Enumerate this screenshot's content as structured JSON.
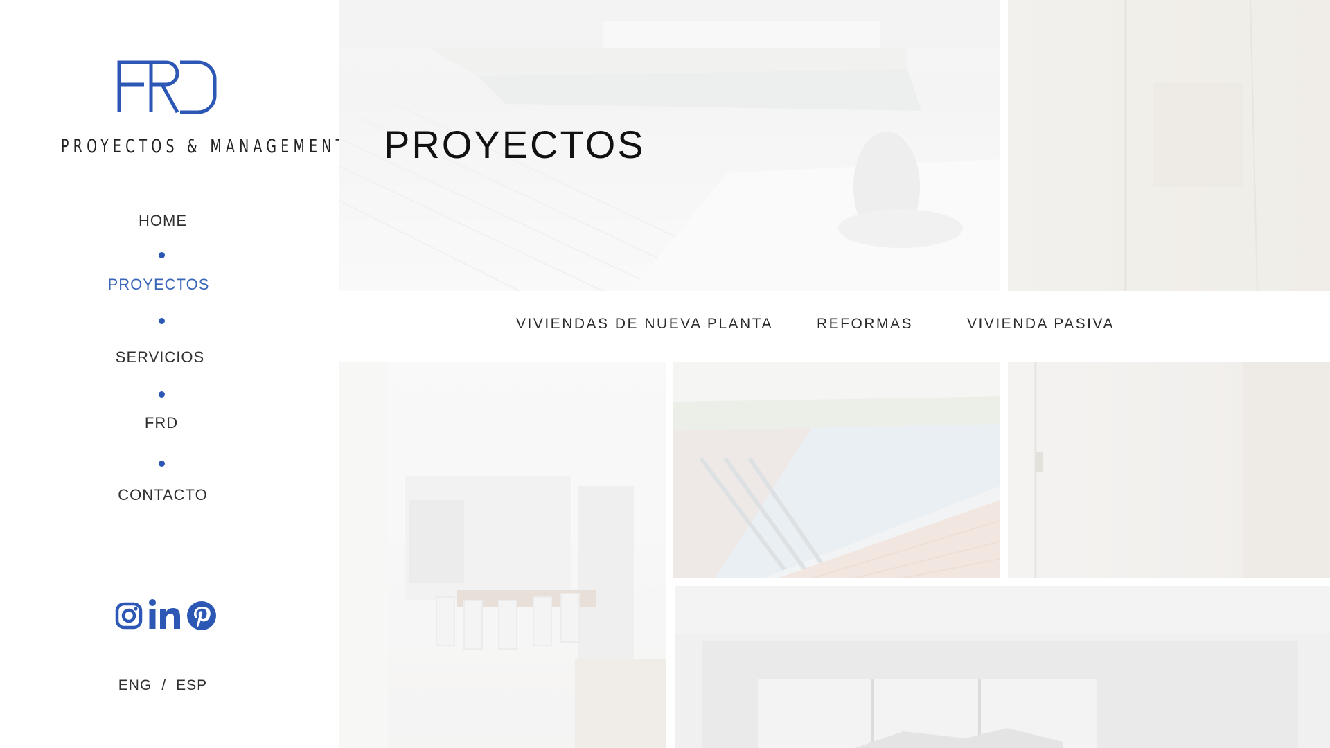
{
  "brand": {
    "logo_text": "FRD",
    "tagline": "PROYECTOS & MANAGEMENT",
    "accent_color": "#2c57b5"
  },
  "nav": {
    "items": [
      {
        "label": "HOME",
        "active": false
      },
      {
        "label": "PROYECTOS",
        "active": true
      },
      {
        "label": "SERVICIOS",
        "active": false
      },
      {
        "label": "FRD",
        "active": false
      },
      {
        "label": "CONTACTO",
        "active": false
      }
    ]
  },
  "social": {
    "icons": [
      "instagram-icon",
      "linkedin-icon",
      "pinterest-icon"
    ]
  },
  "language": {
    "options": [
      "ENG",
      "ESP"
    ],
    "separator": "/"
  },
  "hero": {
    "title": "PROYECTOS"
  },
  "categories": {
    "tabs": [
      "VIVIENDAS DE NUEVA PLANTA",
      "REFORMAS",
      "VIVIENDA PASIVA"
    ]
  }
}
